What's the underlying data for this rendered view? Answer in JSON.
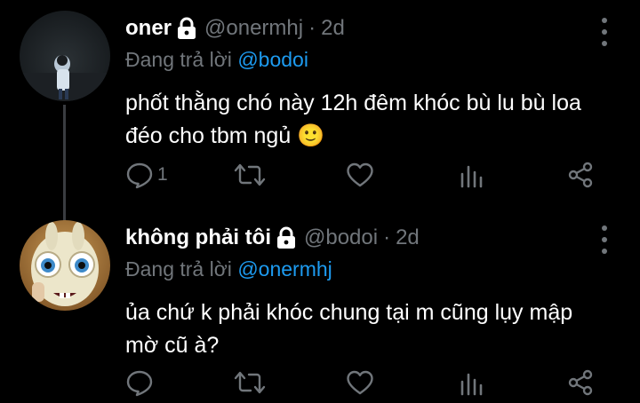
{
  "colors": {
    "background": "#000000",
    "text_primary": "#ffffff",
    "text_secondary": "#71767b",
    "accent": "#1d9bf0",
    "thread_line": "#3a3d41"
  },
  "tweets": [
    {
      "display_name": "oner",
      "protected_icon": "lock-icon",
      "handle": "@onermhj",
      "separator": "·",
      "time": "2d",
      "replying_prefix": "Đang trả lời ",
      "replying_to": "@bodoi",
      "text": "phốt thằng chó này 12h đêm khóc bù lu bù loa đéo cho tbm ngủ 🙂",
      "reply_count": "1",
      "actions": [
        "reply-icon",
        "retweet-icon",
        "like-icon",
        "analytics-icon",
        "share-icon"
      ]
    },
    {
      "display_name": "không phải tôi",
      "protected_icon": "lock-icon",
      "handle": "@bodoi",
      "separator": "·",
      "time": "2d",
      "replying_prefix": "Đang trả lời ",
      "replying_to": "@onermhj",
      "text": "ủa chứ k phải khóc chung tại m cũng lụy mập mờ cũ à?",
      "reply_count": "",
      "actions": [
        "reply-icon",
        "retweet-icon",
        "like-icon",
        "analytics-icon",
        "share-icon"
      ]
    }
  ]
}
